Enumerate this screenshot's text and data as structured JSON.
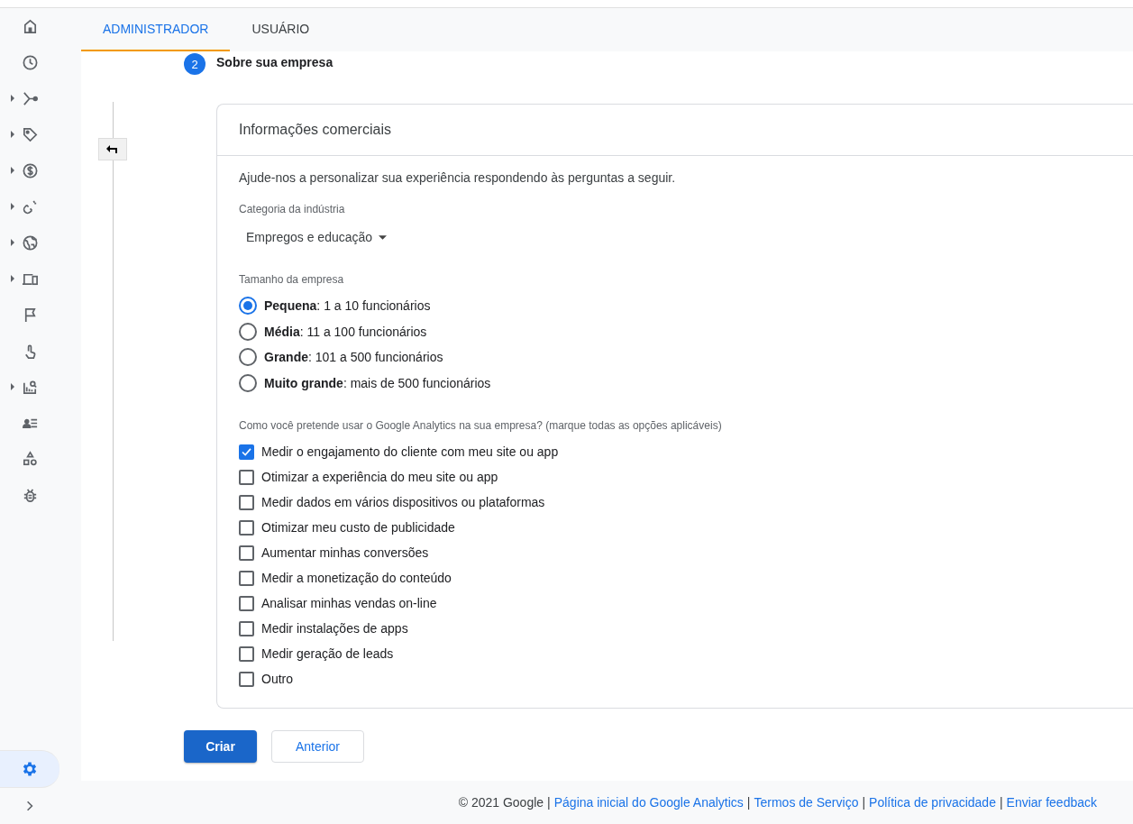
{
  "sidebar": {
    "items": [
      {
        "expandable": false,
        "selected": false
      },
      {
        "expandable": false,
        "selected": false
      },
      {
        "expandable": true,
        "selected": false
      },
      {
        "expandable": true,
        "selected": false
      },
      {
        "expandable": true,
        "selected": false
      },
      {
        "expandable": true,
        "selected": false
      },
      {
        "expandable": true,
        "selected": false
      },
      {
        "expandable": true,
        "selected": false
      },
      {
        "expandable": false,
        "selected": false
      },
      {
        "expandable": false,
        "selected": false
      },
      {
        "expandable": true,
        "selected": false
      },
      {
        "expandable": false,
        "selected": false
      },
      {
        "expandable": false,
        "selected": false
      },
      {
        "expandable": false,
        "selected": false
      }
    ],
    "settings": {
      "selected": true
    }
  },
  "tabs": [
    {
      "label": "ADMINISTRADOR",
      "selected": true
    },
    {
      "label": "USUÁRIO",
      "selected": false
    }
  ],
  "step": {
    "number": "2",
    "title": "Sobre sua empresa"
  },
  "card": {
    "title": "Informações comerciais",
    "intro": "Ajude-nos a personalizar sua experiência respondendo às perguntas a seguir.",
    "industry": {
      "label": "Categoria da indústria",
      "value": "Empregos e educação"
    },
    "size": {
      "label": "Tamanho da empresa",
      "options": [
        {
          "text": "**Pequena**: 1 a 10 funcionários",
          "selected": true
        },
        {
          "text": "**Média**: 11 a 100 funcionários",
          "selected": false
        },
        {
          "text": "**Grande**: 101 a 500 funcionários",
          "selected": false
        },
        {
          "text": "**Muito grande**: mais de 500 funcionários",
          "selected": false
        }
      ]
    },
    "usage": {
      "label": "Como você pretende usar o Google Analytics na sua empresa? (marque todas as opções aplicáveis)",
      "options": [
        {
          "text": "Medir o engajamento do cliente com meu site ou app",
          "checked": true
        },
        {
          "text": "Otimizar a experiência do meu site ou app",
          "checked": false
        },
        {
          "text": "Medir dados em vários dispositivos ou plataformas",
          "checked": false
        },
        {
          "text": "Otimizar meu custo de publicidade",
          "checked": false
        },
        {
          "text": "Aumentar minhas conversões",
          "checked": false
        },
        {
          "text": "Medir a monetização do conteúdo",
          "checked": false
        },
        {
          "text": "Analisar minhas vendas on-line",
          "checked": false
        },
        {
          "text": "Medir instalações de apps",
          "checked": false
        },
        {
          "text": "Medir geração de leads",
          "checked": false
        },
        {
          "text": "Outro",
          "checked": false
        }
      ]
    }
  },
  "buttons": {
    "primary": "Criar",
    "secondary": "Anterior"
  },
  "footer": {
    "copyright": "© 2021 Google",
    "links": [
      "Página inicial do Google Analytics",
      "Termos de Serviço",
      "Política de privacidade",
      "Enviar feedback"
    ],
    "separator": "|"
  }
}
